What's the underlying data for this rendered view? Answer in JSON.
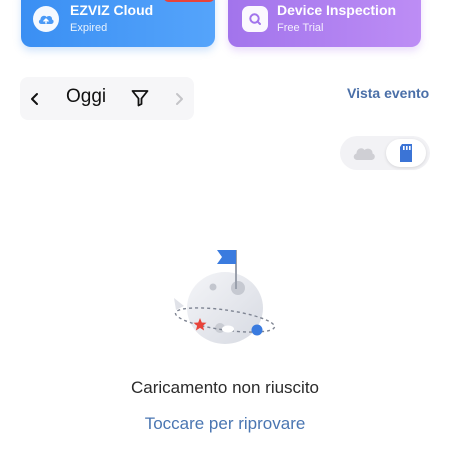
{
  "services": {
    "cloud": {
      "title": "EZVIZ Cloud",
      "status": "Expired",
      "icon": "cloud-upload-icon",
      "color": "#4a9af7"
    },
    "inspection": {
      "title": "Device Inspection",
      "status": "Free Trial",
      "icon": "inspection-icon",
      "color": "#b083f1"
    }
  },
  "date_bar": {
    "label": "Oggi",
    "prev_icon": "chevron-left-icon",
    "next_icon": "chevron-right-icon",
    "filter_icon": "filter-icon"
  },
  "event_view_label": "Vista evento",
  "storage_toggle": {
    "options": [
      "cloud-icon",
      "sd-card-icon"
    ],
    "selected": "sd-card-icon"
  },
  "empty_state": {
    "message": "Caricamento non riuscito",
    "retry_label": "Toccare per riprovare",
    "illustration": "planet-flag-illustration"
  },
  "colors": {
    "accent_link": "#4a76b2",
    "event_view": "#4a6fa8",
    "sd_active": "#3b74d6"
  }
}
